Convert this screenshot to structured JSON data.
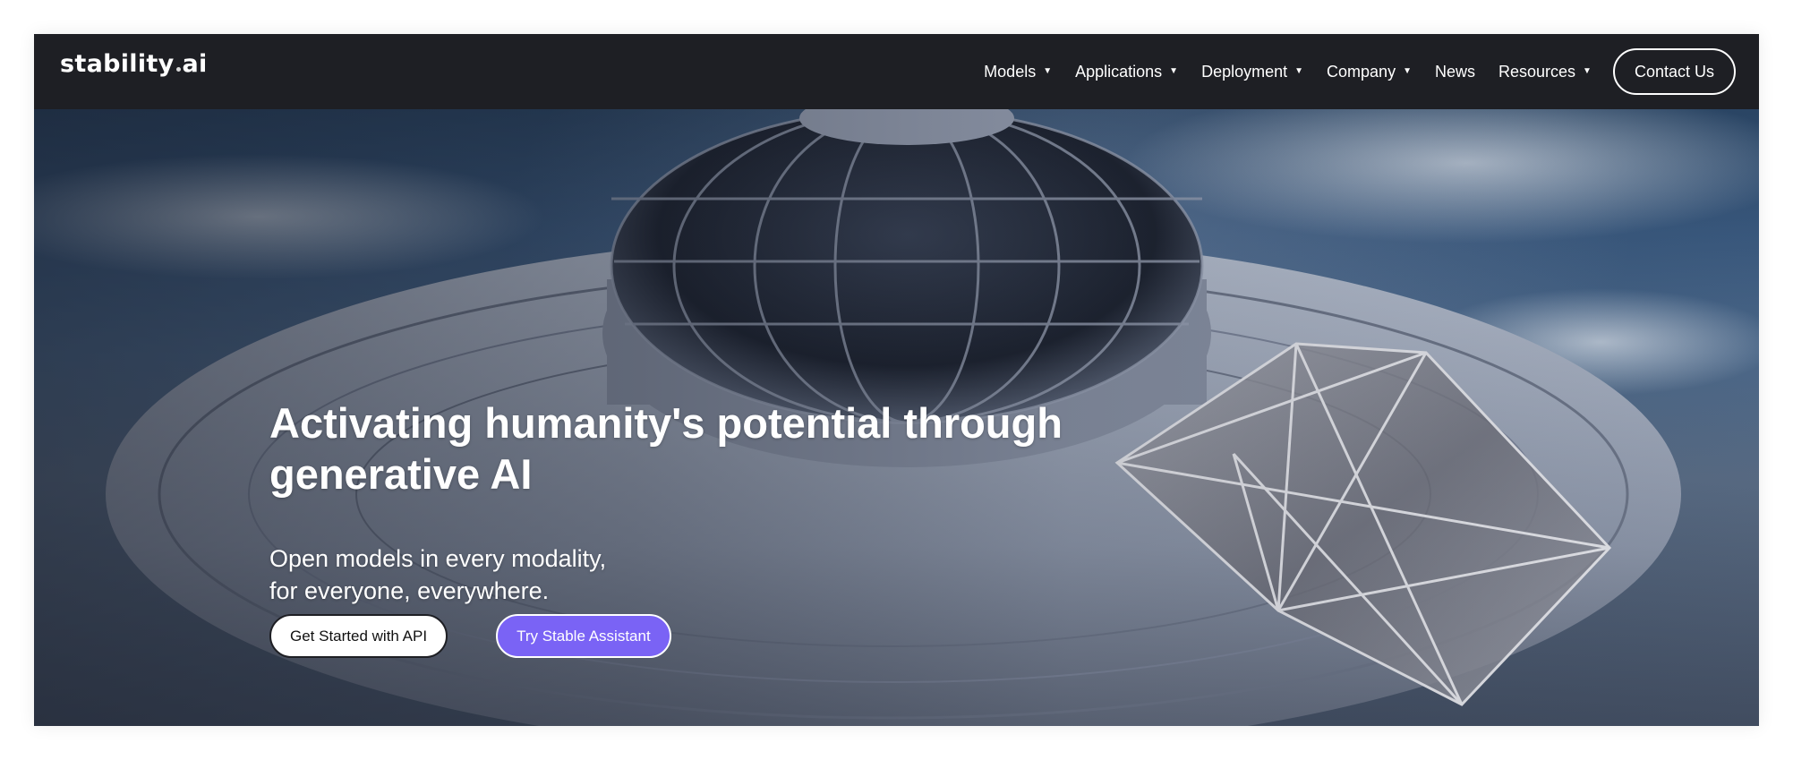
{
  "brand": {
    "logo_left": "stability",
    "logo_right": "ai"
  },
  "nav": {
    "items": [
      {
        "label": "Models",
        "has_caret": true
      },
      {
        "label": "Applications",
        "has_caret": true
      },
      {
        "label": "Deployment",
        "has_caret": true
      },
      {
        "label": "Company",
        "has_caret": true
      },
      {
        "label": "News",
        "has_caret": false
      },
      {
        "label": "Resources",
        "has_caret": true
      }
    ],
    "caret_glyph": "▼",
    "contact_label": "Contact Us"
  },
  "hero": {
    "title": "Activating humanity's potential through generative AI",
    "subtitle_line1": "Open models in every modality,",
    "subtitle_line2": "for everyone, everywhere.",
    "cta_primary": "Get Started with API",
    "cta_secondary": "Try Stable Assistant"
  },
  "colors": {
    "nav_bg": "#1e1f24",
    "accent_purple": "#7a63f5",
    "text_white": "#ffffff"
  }
}
